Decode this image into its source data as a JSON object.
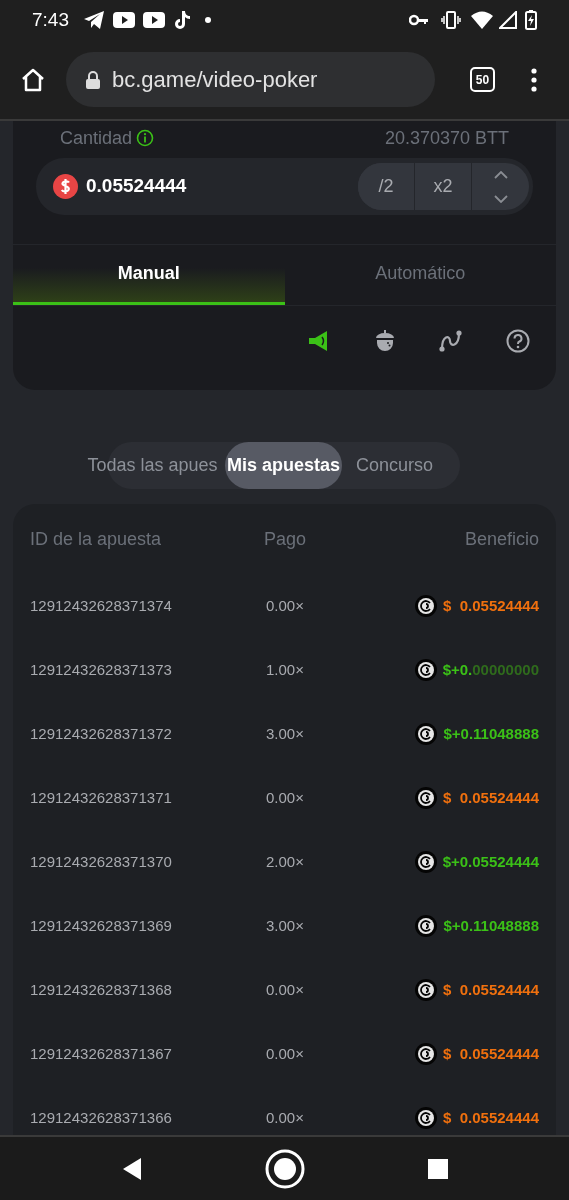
{
  "status_bar": {
    "time": "7:43"
  },
  "browser": {
    "url": "bc.game/video-poker",
    "tab_count": "50"
  },
  "amount": {
    "label": "Cantidad",
    "balance": "20.370370 BTT",
    "value": "0.05524444",
    "half": "/2",
    "double": "x2"
  },
  "mode_tabs": [
    {
      "label": "Manual",
      "selected": true
    },
    {
      "label": "Automático",
      "selected": false
    }
  ],
  "tools": [
    {
      "kind": "sound",
      "on": true
    },
    {
      "kind": "acorn",
      "on": false
    },
    {
      "kind": "curve",
      "on": false
    },
    {
      "kind": "help",
      "on": false
    }
  ],
  "bet_tabs": [
    {
      "label": "Todas las apues",
      "selected": false
    },
    {
      "label": "Mis apuestas",
      "selected": true
    },
    {
      "label": "Concurso",
      "selected": false
    }
  ],
  "table": {
    "columns": [
      "ID de la apuesta",
      "Pago",
      "Beneficio"
    ],
    "rows": [
      {
        "id": "12912432628371374",
        "payout": "0.00×",
        "currency": "$",
        "sign": "",
        "amount": "0.05524444",
        "kind": "loss"
      },
      {
        "id": "12912432628371373",
        "payout": "1.00×",
        "currency": "$",
        "sign": "+",
        "amount": "0.00000000",
        "kind": "win"
      },
      {
        "id": "12912432628371372",
        "payout": "3.00×",
        "currency": "$",
        "sign": "+",
        "amount": "0.11048888",
        "kind": "win"
      },
      {
        "id": "12912432628371371",
        "payout": "0.00×",
        "currency": "$",
        "sign": "",
        "amount": "0.05524444",
        "kind": "loss"
      },
      {
        "id": "12912432628371370",
        "payout": "2.00×",
        "currency": "$",
        "sign": "+",
        "amount": "0.05524444",
        "kind": "win"
      },
      {
        "id": "12912432628371369",
        "payout": "3.00×",
        "currency": "$",
        "sign": "+",
        "amount": "0.11048888",
        "kind": "win"
      },
      {
        "id": "12912432628371368",
        "payout": "0.00×",
        "currency": "$",
        "sign": "",
        "amount": "0.05524444",
        "kind": "loss"
      },
      {
        "id": "12912432628371367",
        "payout": "0.00×",
        "currency": "$",
        "sign": "",
        "amount": "0.05524444",
        "kind": "loss"
      },
      {
        "id": "12912432628371366",
        "payout": "0.00×",
        "currency": "$",
        "sign": "",
        "amount": "0.05524444",
        "kind": "loss"
      }
    ]
  }
}
